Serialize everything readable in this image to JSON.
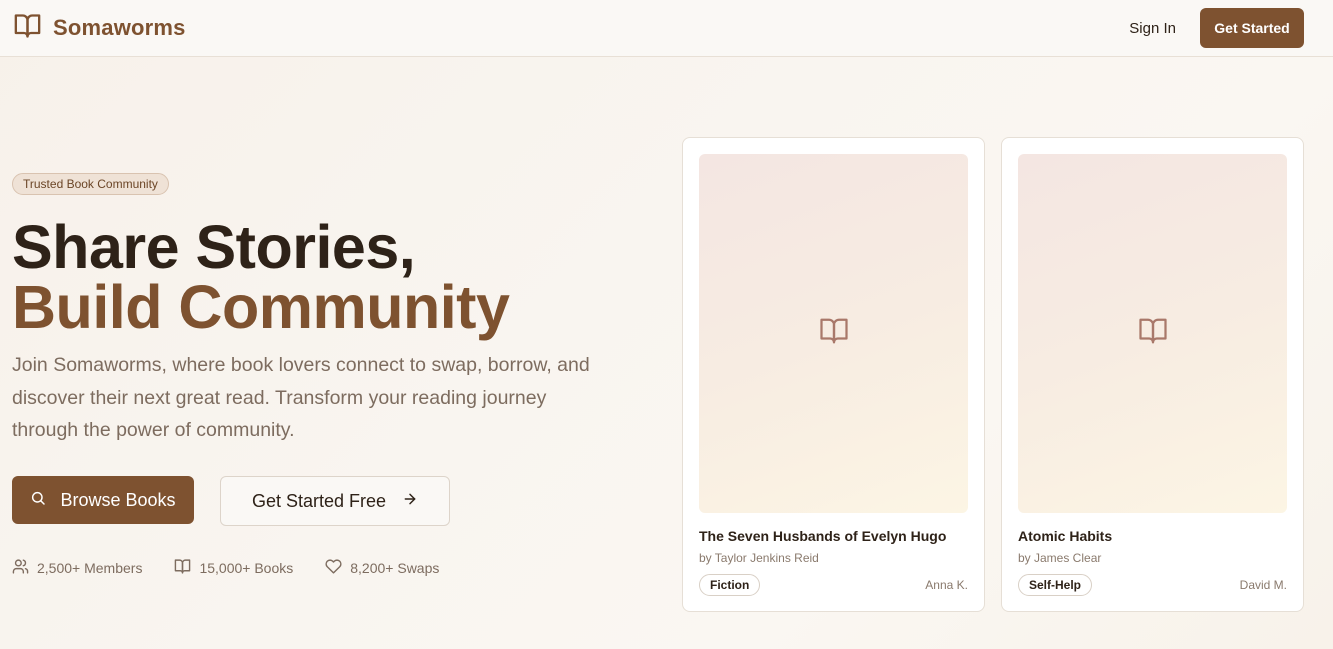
{
  "nav": {
    "brand": "Somaworms",
    "brand_icon": "open-book-icon",
    "sign_in": "Sign In",
    "get_started": "Get Started"
  },
  "hero": {
    "badge": "Trusted Book Community",
    "headline_line1": "Share Stories,",
    "headline_line2": "Build Community",
    "description": "Join Somaworms, where book lovers connect to swap, borrow, and discover their next great read. Transform your reading journey through the power of community.",
    "browse_button": "Browse Books",
    "free_button": "Get Started Free"
  },
  "stats": [
    {
      "icon": "users-icon",
      "label": "2,500+ Members"
    },
    {
      "icon": "book-icon",
      "label": "15,000+ Books"
    },
    {
      "icon": "heart-icon",
      "label": "8,200+ Swaps"
    }
  ],
  "books": [
    {
      "title": "The Seven Husbands of Evelyn Hugo",
      "author": "by Taylor Jenkins Reid",
      "genre": "Fiction",
      "owner": "Anna K."
    },
    {
      "title": "Atomic Habits",
      "author": "by James Clear",
      "genre": "Self-Help",
      "owner": "David M."
    }
  ],
  "colors": {
    "brand": "#7e5230",
    "heading": "#2e2218",
    "muted": "#7d6c5f"
  }
}
